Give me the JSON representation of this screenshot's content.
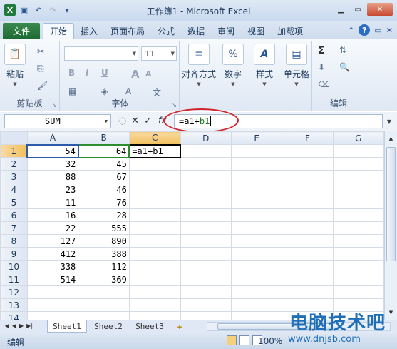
{
  "window": {
    "title": "工作簿1 - Microsoft Excel"
  },
  "quick_access": {
    "app_icon": "excel-icon",
    "items": [
      "save-icon",
      "undo-icon",
      "redo-icon",
      "customize-icon"
    ]
  },
  "tabs": {
    "file": "文件",
    "items": [
      "开始",
      "插入",
      "页面布局",
      "公式",
      "数据",
      "审阅",
      "视图",
      "加载项"
    ],
    "active": "开始"
  },
  "ribbon": {
    "clipboard": {
      "paste": "粘贴",
      "label": "剪贴板"
    },
    "font": {
      "size": "11",
      "bold": "B",
      "italic": "I",
      "underline": "U",
      "grow": "A",
      "shrink": "A",
      "label": "字体"
    },
    "align": {
      "label": "对齐方式"
    },
    "number": {
      "symbol": "%",
      "label": "数字"
    },
    "style": {
      "symbol": "A",
      "label": "样式"
    },
    "cells": {
      "label": "单元格"
    },
    "edit": {
      "sum": "Σ",
      "label": "编辑"
    }
  },
  "formula_bar": {
    "name_box": "SUM",
    "cancel": "✕",
    "enter": "✓",
    "fx": "fx",
    "formula_prefix": "=a1+",
    "formula_ref2": "b1"
  },
  "grid": {
    "columns": [
      "A",
      "B",
      "C",
      "D",
      "E",
      "F",
      "G"
    ],
    "rows": [
      {
        "n": "1",
        "a": "54",
        "b": "64",
        "c": "=a1+b1"
      },
      {
        "n": "2",
        "a": "32",
        "b": "45",
        "c": ""
      },
      {
        "n": "3",
        "a": "88",
        "b": "67",
        "c": ""
      },
      {
        "n": "4",
        "a": "23",
        "b": "46",
        "c": ""
      },
      {
        "n": "5",
        "a": "11",
        "b": "76",
        "c": ""
      },
      {
        "n": "6",
        "a": "16",
        "b": "28",
        "c": ""
      },
      {
        "n": "7",
        "a": "22",
        "b": "555",
        "c": ""
      },
      {
        "n": "8",
        "a": "127",
        "b": "890",
        "c": ""
      },
      {
        "n": "9",
        "a": "412",
        "b": "388",
        "c": ""
      },
      {
        "n": "10",
        "a": "338",
        "b": "112",
        "c": ""
      },
      {
        "n": "11",
        "a": "514",
        "b": "369",
        "c": ""
      },
      {
        "n": "12",
        "a": "",
        "b": "",
        "c": ""
      },
      {
        "n": "13",
        "a": "",
        "b": "",
        "c": ""
      },
      {
        "n": "14",
        "a": "",
        "b": "",
        "c": ""
      }
    ]
  },
  "sheets": {
    "items": [
      "Sheet1",
      "Sheet2",
      "Sheet3"
    ],
    "active": "Sheet1"
  },
  "status": {
    "mode": "编辑",
    "zoom": "100%",
    "zoom_out": "−"
  },
  "watermark": {
    "line1": "电脑技术吧",
    "line2": "www.dnjsb.com"
  },
  "colors": {
    "file_tab": "#1e6b34",
    "ref_a": "#2a5aa8",
    "ref_b": "#2e8b2e",
    "annotation_ring": "#d3262b"
  }
}
